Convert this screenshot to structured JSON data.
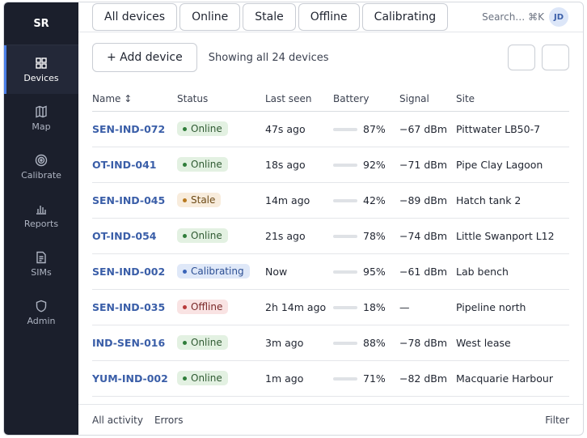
{
  "brand": "SR",
  "sidebar": {
    "items": [
      {
        "label": "Devices",
        "icon": "grid-icon"
      },
      {
        "label": "Map",
        "icon": "map-icon"
      },
      {
        "label": "Calibrate",
        "icon": "target-icon"
      },
      {
        "label": "Reports",
        "icon": "bar-chart-icon"
      },
      {
        "label": "SIMs",
        "icon": "document-icon"
      },
      {
        "label": "Admin",
        "icon": "shield-icon"
      }
    ]
  },
  "tabs": [
    "All devices",
    "Online",
    "Stale",
    "Offline",
    "Calibrating"
  ],
  "search": {
    "label": "Search… ⌘K"
  },
  "user": {
    "initials": "JD"
  },
  "actions": {
    "add_label": "+ Add device",
    "count_text": "Showing all 24 devices"
  },
  "table": {
    "headers": [
      "Name ↕",
      "Status",
      "Last seen",
      "Battery",
      "Signal",
      "Site"
    ],
    "rows": [
      {
        "name": "SEN-IND-072",
        "status": "Online",
        "last_seen": "47s ago",
        "battery": "87%",
        "signal": "−67 dBm",
        "site": "Pittwater LB50-7"
      },
      {
        "name": "OT-IND-041",
        "status": "Online",
        "last_seen": "18s ago",
        "battery": "92%",
        "signal": "−71 dBm",
        "site": "Pipe Clay Lagoon"
      },
      {
        "name": "SEN-IND-045",
        "status": "Stale",
        "last_seen": "14m ago",
        "battery": "42%",
        "signal": "−89 dBm",
        "site": "Hatch tank 2"
      },
      {
        "name": "OT-IND-054",
        "status": "Online",
        "last_seen": "21s ago",
        "battery": "78%",
        "signal": "−74 dBm",
        "site": "Little Swanport L12"
      },
      {
        "name": "SEN-IND-002",
        "status": "Calibrating",
        "last_seen": "Now",
        "battery": "95%",
        "signal": "−61 dBm",
        "site": "Lab bench"
      },
      {
        "name": "SEN-IND-035",
        "status": "Offline",
        "last_seen": "2h 14m ago",
        "battery": "18%",
        "signal": "—",
        "site": "Pipeline north"
      },
      {
        "name": "IND-SEN-016",
        "status": "Online",
        "last_seen": "3m ago",
        "battery": "88%",
        "signal": "−78 dBm",
        "site": "West lease"
      },
      {
        "name": "YUM-IND-002",
        "status": "Online",
        "last_seen": "1m ago",
        "battery": "71%",
        "signal": "−82 dBm",
        "site": "Macquarie Harbour"
      }
    ]
  },
  "status_colors": {
    "Online": {
      "bg": "#e3f1e2",
      "dot": "#2f7d3a",
      "text": "#2f5a32"
    },
    "Stale": {
      "bg": "#f8ecdc",
      "dot": "#b8791f",
      "text": "#6d4a16"
    },
    "Offline": {
      "bg": "#f9e3e3",
      "dot": "#b83a3a",
      "text": "#7a2828"
    },
    "Calibrating": {
      "bg": "#dfe8f8",
      "dot": "#3a64b8",
      "text": "#2c4f94"
    }
  },
  "footer": {
    "activity": "All activity",
    "errors": "Errors",
    "filter": "Filter"
  }
}
